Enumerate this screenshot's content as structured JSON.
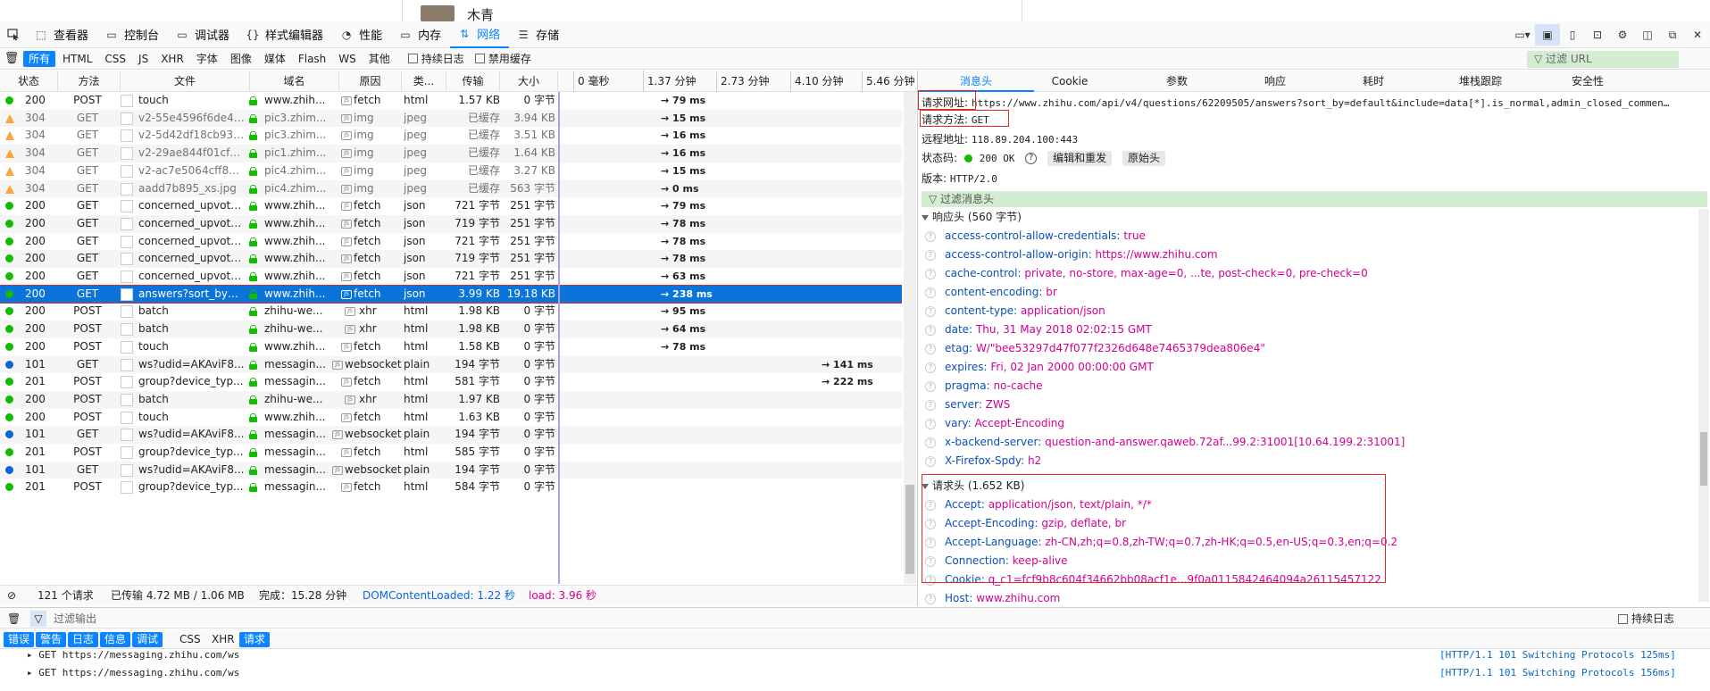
{
  "page_remnant": {
    "name": "木青"
  },
  "toolbar": {
    "tabs": [
      {
        "label": "查看器",
        "icon": "inspector-icon"
      },
      {
        "label": "控制台",
        "icon": "console-icon"
      },
      {
        "label": "调试器",
        "icon": "debugger-icon"
      },
      {
        "label": "样式编辑器",
        "icon": "style-editor-icon"
      },
      {
        "label": "性能",
        "icon": "performance-icon"
      },
      {
        "label": "内存",
        "icon": "memory-icon"
      },
      {
        "label": "网络",
        "icon": "network-icon"
      },
      {
        "label": "存储",
        "icon": "storage-icon"
      }
    ],
    "active_tab": "网络"
  },
  "filter_bar": {
    "types": [
      "所有",
      "HTML",
      "CSS",
      "JS",
      "XHR",
      "字体",
      "图像",
      "媒体",
      "Flash",
      "WS",
      "其他"
    ],
    "persist_logs": "持续日志",
    "disable_cache": "禁用缓存",
    "url_filter_placeholder": "过滤 URL"
  },
  "columns": [
    "状态",
    "方法",
    "文件",
    "域名",
    "原因",
    "类...",
    "传输",
    "大小"
  ],
  "timeline_ticks": [
    "0 毫秒",
    "1.37 分钟",
    "2.73 分钟",
    "4.10 分钟",
    "5.46 分钟"
  ],
  "requests": [
    {
      "status": "200",
      "method": "POST",
      "file": "touch",
      "domain": "www.zhih...",
      "cause": "fetch",
      "type": "html",
      "transfer": "1.57 KB",
      "size": "0 字节",
      "time": "→ 79 ms",
      "kind": "ok"
    },
    {
      "status": "304",
      "method": "GET",
      "file": "v2-55e4596f6de40...",
      "domain": "pic3.zhim...",
      "cause": "img",
      "type": "jpeg",
      "transfer": "已缓存",
      "size": "3.94 KB",
      "time": "→ 15 ms",
      "kind": "cached"
    },
    {
      "status": "304",
      "method": "GET",
      "file": "v2-5d42df18cb93e...",
      "domain": "pic3.zhim...",
      "cause": "img",
      "type": "jpeg",
      "transfer": "已缓存",
      "size": "3.51 KB",
      "time": "→ 16 ms",
      "kind": "cached"
    },
    {
      "status": "304",
      "method": "GET",
      "file": "v2-29ae844f01cf4...",
      "domain": "pic1.zhim...",
      "cause": "img",
      "type": "jpeg",
      "transfer": "已缓存",
      "size": "1.64 KB",
      "time": "→ 16 ms",
      "kind": "cached"
    },
    {
      "status": "304",
      "method": "GET",
      "file": "v2-ac7e5064cff89...",
      "domain": "pic4.zhim...",
      "cause": "img",
      "type": "jpeg",
      "transfer": "已缓存",
      "size": "3.27 KB",
      "time": "→ 15 ms",
      "kind": "cached"
    },
    {
      "status": "304",
      "method": "GET",
      "file": "aadd7b895_xs.jpg",
      "domain": "pic4.zhim...",
      "cause": "img",
      "type": "jpeg",
      "transfer": "已缓存",
      "size": "563 字节",
      "time": "→ 0 ms",
      "kind": "cached"
    },
    {
      "status": "200",
      "method": "GET",
      "file": "concerned_upvote...",
      "domain": "www.zhih...",
      "cause": "fetch",
      "type": "json",
      "transfer": "721 字节",
      "size": "251 字节",
      "time": "→ 79 ms",
      "kind": "ok"
    },
    {
      "status": "200",
      "method": "GET",
      "file": "concerned_upvote...",
      "domain": "www.zhih...",
      "cause": "fetch",
      "type": "json",
      "transfer": "719 字节",
      "size": "251 字节",
      "time": "→ 78 ms",
      "kind": "ok"
    },
    {
      "status": "200",
      "method": "GET",
      "file": "concerned_upvote...",
      "domain": "www.zhih...",
      "cause": "fetch",
      "type": "json",
      "transfer": "721 字节",
      "size": "251 字节",
      "time": "→ 78 ms",
      "kind": "ok"
    },
    {
      "status": "200",
      "method": "GET",
      "file": "concerned_upvote...",
      "domain": "www.zhih...",
      "cause": "fetch",
      "type": "json",
      "transfer": "719 字节",
      "size": "251 字节",
      "time": "→ 78 ms",
      "kind": "ok"
    },
    {
      "status": "200",
      "method": "GET",
      "file": "concerned_upvote...",
      "domain": "www.zhih...",
      "cause": "fetch",
      "type": "json",
      "transfer": "721 字节",
      "size": "251 字节",
      "time": "→ 63 ms",
      "kind": "ok"
    },
    {
      "status": "200",
      "method": "GET",
      "file": "answers?sort_by=...",
      "domain": "www.zhih...",
      "cause": "fetch",
      "type": "json",
      "transfer": "3.99 KB",
      "size": "19.18 KB",
      "time": "→ 238 ms",
      "kind": "selected"
    },
    {
      "status": "200",
      "method": "POST",
      "file": "batch",
      "domain": "zhihu-we...",
      "cause": "xhr",
      "type": "html",
      "transfer": "1.98 KB",
      "size": "0 字节",
      "time": "→ 95 ms",
      "kind": "ok"
    },
    {
      "status": "200",
      "method": "POST",
      "file": "batch",
      "domain": "zhihu-we...",
      "cause": "xhr",
      "type": "html",
      "transfer": "1.98 KB",
      "size": "0 字节",
      "time": "→ 64 ms",
      "kind": "ok"
    },
    {
      "status": "200",
      "method": "POST",
      "file": "touch",
      "domain": "www.zhih...",
      "cause": "fetch",
      "type": "html",
      "transfer": "1.58 KB",
      "size": "0 字节",
      "time": "→ 78 ms",
      "kind": "ok"
    },
    {
      "status": "101",
      "method": "GET",
      "file": "ws?udid=AKAviF8...",
      "domain": "messagin...",
      "cause": "websocket",
      "type": "plain",
      "transfer": "194 字节",
      "size": "0 字节",
      "time": "→ 141 ms",
      "kind": "ws"
    },
    {
      "status": "201",
      "method": "POST",
      "file": "group?device_typ...",
      "domain": "messagin...",
      "cause": "fetch",
      "type": "html",
      "transfer": "581 字节",
      "size": "0 字节",
      "time": "→ 222 ms",
      "kind": "ok"
    },
    {
      "status": "200",
      "method": "POST",
      "file": "batch",
      "domain": "zhihu-we...",
      "cause": "xhr",
      "type": "html",
      "transfer": "1.97 KB",
      "size": "0 字节",
      "time": "",
      "kind": "ok"
    },
    {
      "status": "200",
      "method": "POST",
      "file": "touch",
      "domain": "www.zhih...",
      "cause": "fetch",
      "type": "html",
      "transfer": "1.63 KB",
      "size": "0 字节",
      "time": "",
      "kind": "ok"
    },
    {
      "status": "101",
      "method": "GET",
      "file": "ws?udid=AKAviF8...",
      "domain": "messagin...",
      "cause": "websocket",
      "type": "plain",
      "transfer": "194 字节",
      "size": "0 字节",
      "time": "",
      "kind": "ws"
    },
    {
      "status": "201",
      "method": "POST",
      "file": "group?device_typ...",
      "domain": "messagin...",
      "cause": "fetch",
      "type": "html",
      "transfer": "585 字节",
      "size": "0 字节",
      "time": "",
      "kind": "ok"
    },
    {
      "status": "101",
      "method": "GET",
      "file": "ws?udid=AKAviF8...",
      "domain": "messagin...",
      "cause": "websocket",
      "type": "plain",
      "transfer": "194 字节",
      "size": "0 字节",
      "time": "",
      "kind": "ws"
    },
    {
      "status": "201",
      "method": "POST",
      "file": "group?device_typ...",
      "domain": "messagin...",
      "cause": "fetch",
      "type": "html",
      "transfer": "584 字节",
      "size": "0 字节",
      "time": "",
      "kind": "ok"
    }
  ],
  "status_bar": {
    "count": "121 个请求",
    "transferred": "已传输 4.72 MB / 1.06 MB",
    "finish": "完成：15.28 分钟",
    "dom": "DOMContentLoaded: 1.22 秒",
    "load": "load: 3.96 秒"
  },
  "details": {
    "tabs": [
      "消息头",
      "Cookie",
      "参数",
      "响应",
      "耗时",
      "堆栈跟踪",
      "安全性"
    ],
    "active_tab": "消息头",
    "request_url_label": "请求网址:",
    "request_url": "https://www.zhihu.com/api/v4/questions/62209505/answers?sort_by=default&include=data[*].is_normal,admin_closed_commen…",
    "request_method_label": "请求方法:",
    "request_method": "GET",
    "remote_addr_label": "远程地址:",
    "remote_addr": "118.89.204.100:443",
    "status_code_label": "状态码:",
    "status_code": "200 OK",
    "edit_resend": "编辑和重发",
    "raw_headers": "原始头",
    "version_label": "版本:",
    "version": "HTTP/2.0",
    "filter_headers": "过滤消息头",
    "response_headers_title": "响应头 (560 字节)",
    "response_headers": [
      {
        "k": "access-control-allow-credentials:",
        "v": "true"
      },
      {
        "k": "access-control-allow-origin:",
        "v": "https://www.zhihu.com"
      },
      {
        "k": "cache-control:",
        "v": "private, no-store, max-age=0, ...te, post-check=0, pre-check=0"
      },
      {
        "k": "content-encoding:",
        "v": "br"
      },
      {
        "k": "content-type:",
        "v": "application/json"
      },
      {
        "k": "date:",
        "v": "Thu, 31 May 2018 02:02:15 GMT"
      },
      {
        "k": "etag:",
        "v": "W/\"bee53297d47f077f2326d648e7465379dea806e4\""
      },
      {
        "k": "expires:",
        "v": "Fri, 02 Jan 2000 00:00:00 GMT"
      },
      {
        "k": "pragma:",
        "v": "no-cache"
      },
      {
        "k": "server:",
        "v": "ZWS"
      },
      {
        "k": "vary:",
        "v": "Accept-Encoding"
      },
      {
        "k": "x-backend-server:",
        "v": "question-and-answer.qaweb.72af...99.2:31001[10.64.199.2:31001]"
      },
      {
        "k": "X-Firefox-Spdy:",
        "v": "h2"
      }
    ],
    "request_headers_title": "请求头 (1.652 KB)",
    "request_headers": [
      {
        "k": "Accept:",
        "v": "application/json, text/plain, */*"
      },
      {
        "k": "Accept-Encoding:",
        "v": "gzip, deflate, br"
      },
      {
        "k": "Accept-Language:",
        "v": "zh-CN,zh;q=0.8,zh-TW;q=0.7,zh-HK;q=0.5,en-US;q=0.3,en;q=0.2"
      },
      {
        "k": "Connection:",
        "v": "keep-alive"
      },
      {
        "k": "Cookie:",
        "v": "q_c1=fcf9b8c604f34662bb08acf1e...9f0a0115842464094a26115457122"
      },
      {
        "k": "Host:",
        "v": "www.zhihu.com"
      }
    ]
  },
  "console": {
    "filter_placeholder": "过滤输出",
    "persist_logs": "持续日志",
    "categories": [
      "错误",
      "警告",
      "日志",
      "信息",
      "调试",
      "CSS",
      "XHR",
      "请求"
    ],
    "logs": [
      {
        "text": "GET https://messaging.zhihu.com/ws",
        "right": "[HTTP/1.1 101 Switching Protocols 125ms]"
      },
      {
        "text": "GET https://messaging.zhihu.com/ws",
        "right": "[HTTP/1.1 101 Switching Protocols 156ms]"
      }
    ]
  },
  "colors": {
    "accent": "#0a84ff",
    "ok": "#12bc00",
    "cached": "#ffa436",
    "ws": "#0a66d8",
    "selected": "#0a74da",
    "highlight": "#e02a2a"
  }
}
